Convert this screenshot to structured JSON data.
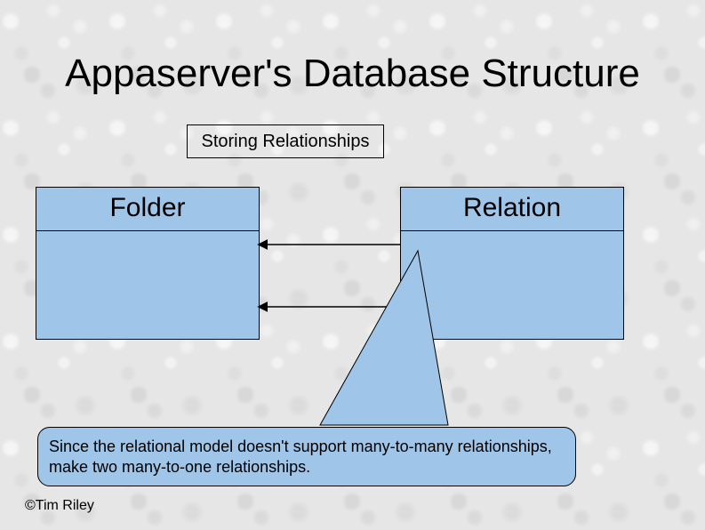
{
  "title": "Appaserver's Database Structure",
  "subtitle": "Storing Relationships",
  "entities": {
    "left": "Folder",
    "right": "Relation"
  },
  "note": "Since the relational model doesn't support many-to-many relationships, make two many-to-one relationships.",
  "copyright": "©Tim Riley",
  "colors": {
    "box_fill": "#9fc5e8"
  }
}
